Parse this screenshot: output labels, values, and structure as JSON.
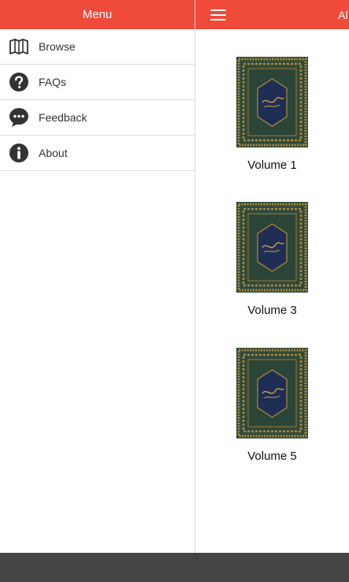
{
  "menu": {
    "title": "Menu",
    "items": [
      {
        "label": "Browse",
        "icon": "map-icon"
      },
      {
        "label": "FAQs",
        "icon": "question-icon"
      },
      {
        "label": "Feedback",
        "icon": "chat-bubble-icon"
      },
      {
        "label": "About",
        "icon": "info-icon"
      }
    ]
  },
  "header": {
    "title": "Al",
    "menu_icon": "hamburger-icon"
  },
  "books": [
    {
      "label": "Volume 1"
    },
    {
      "label": "Volume 3"
    },
    {
      "label": "Volume 5"
    }
  ],
  "colors": {
    "accent": "#ef4a3a",
    "bottom_bar": "#444444",
    "cover_green": "#2f4a3c",
    "cover_gold": "#b38a3a",
    "cover_navy": "#1f2e55"
  }
}
